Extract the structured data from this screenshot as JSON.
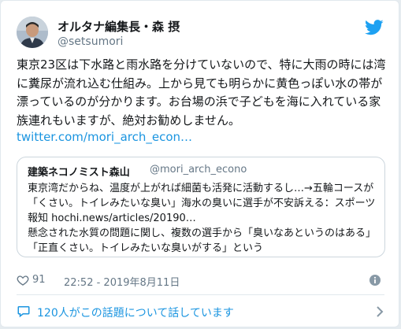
{
  "author": {
    "name": "オルタナ編集長・森 摂",
    "handle": "@setsumori"
  },
  "tweet": {
    "text": "東京23区は下水路と雨水路を分けていないので、特に大雨の時には湾に糞尿が流れ込む仕組み。上から見ても明らかに黄色っぽい水の帯が漂っているのが分かります。お台場の浜で子どもを海に入れている家族連れもいますが、絶対お勧めしません。",
    "link": "twitter.com/mori_arch_econ…"
  },
  "quote": {
    "name": "建築ネコノミスト森山",
    "handle": "@mori_arch_econo",
    "body": "東京湾だからね、温度が上がれば細菌も活発に活動するし…→五輪コースが「くさい。トイレみたいな臭い」海水の臭いに選手が不安訴える：スポーツ報知 hochi.news/articles/20190…\n懸念された水質の問題に関し、複数の選手から「臭いなあというのはある」「正直くさい。トイレみたいな臭いがする」という"
  },
  "meta": {
    "likes": "91",
    "timestamp": "22:52 - 2019年8月11日"
  },
  "footer": {
    "text": "120人がこの話題について話しています"
  },
  "icons": {
    "bird": "twitter-bird-icon",
    "heart": "heart-icon",
    "info": "info-icon",
    "bubble": "speech-bubble-icon",
    "chevron": "chevron-right-icon"
  },
  "colors": {
    "link": "#1b95e0",
    "secondary": "#657786",
    "brand": "#1da1f2"
  }
}
